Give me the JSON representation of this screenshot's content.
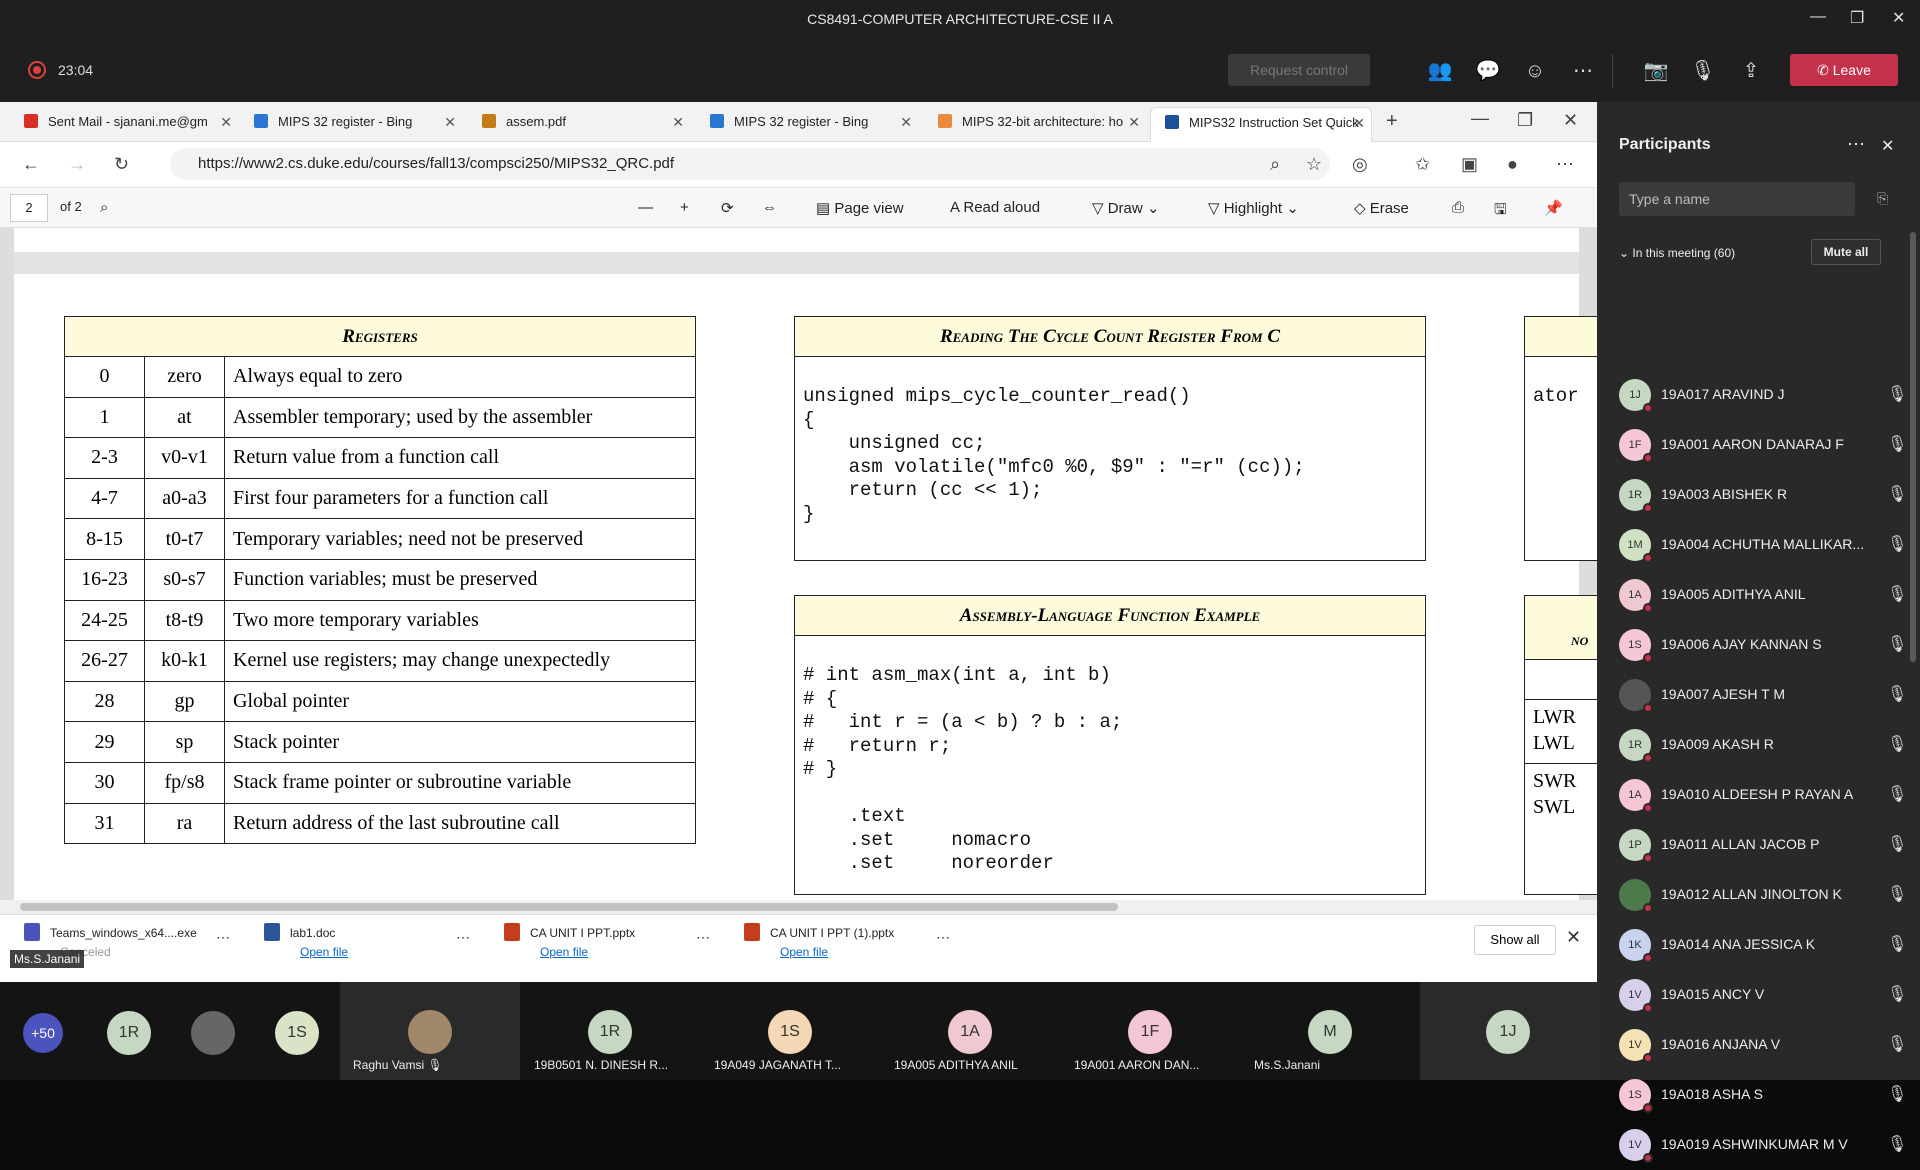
{
  "window": {
    "title": "CS8491-COMPUTER ARCHITECTURE-CSE II A"
  },
  "meeting": {
    "timer": "23:04",
    "request_control": "Request control",
    "leave": "Leave"
  },
  "browser": {
    "tabs": [
      {
        "label": "Sent Mail - sjanani.me@gm",
        "icon": "gmail-icon",
        "color": "#d93025"
      },
      {
        "label": "MIPS 32 register - Bing",
        "icon": "bing-icon",
        "color": "#2a76d2"
      },
      {
        "label": "assem.pdf",
        "icon": "pdf-icon",
        "color": "#c47b16"
      },
      {
        "label": "MIPS 32 register - Bing",
        "icon": "bing-icon",
        "color": "#2a76d2"
      },
      {
        "label": "MIPS 32-bit architecture: ho",
        "icon": "web-icon",
        "color": "#e98a3c"
      },
      {
        "label": "MIPS32 Instruction Set Quick",
        "icon": "pdf-icon",
        "color": "#1e4f9a"
      }
    ],
    "url": "https://www2.cs.duke.edu/courses/fall13/compsci250/MIPS32_QRC.pdf"
  },
  "pdf": {
    "page": "2",
    "of": "of 2",
    "tools": {
      "page_view": "Page view",
      "read_aloud": "Read aloud",
      "draw": "Draw",
      "highlight": "Highlight",
      "erase": "Erase"
    },
    "registers": {
      "heading": "Registers",
      "rows": [
        [
          "0",
          "zero",
          "Always equal to zero"
        ],
        [
          "1",
          "at",
          "Assembler temporary; used by the assembler"
        ],
        [
          "2-3",
          "v0-v1",
          "Return value from a function call"
        ],
        [
          "4-7",
          "a0-a3",
          "First four parameters for a function call"
        ],
        [
          "8-15",
          "t0-t7",
          "Temporary variables; need not be preserved"
        ],
        [
          "16-23",
          "s0-s7",
          "Function variables; must be preserved"
        ],
        [
          "24-25",
          "t8-t9",
          "Two more temporary variables"
        ],
        [
          "26-27",
          "k0-k1",
          "Kernel use registers; may change unexpectedly"
        ],
        [
          "28",
          "gp",
          "Global pointer"
        ],
        [
          "29",
          "sp",
          "Stack pointer"
        ],
        [
          "30",
          "fp/s8",
          "Stack frame pointer or subroutine variable"
        ],
        [
          "31",
          "ra",
          "Return address of the last subroutine call"
        ]
      ]
    },
    "cycle": {
      "heading": "Reading The Cycle Count Register From C",
      "code": "unsigned mips_cycle_counter_read()\n{\n    unsigned cc;\n    asm volatile(\"mfc0 %0, $9\" : \"=r\" (cc));\n    return (cc << 1);\n}"
    },
    "asm": {
      "heading": "Assembly-Language Function Example",
      "code": "# int asm_max(int a, int b)\n# {\n#   int r = (a < b) ? b : a;\n#   return r;\n# }\n\n    .text\n    .set     nomacro\n    .set     noreorder"
    },
    "right_cut": {
      "text1": "ator",
      "heading2": "NO",
      "c1": "LWR",
      "c2": "LWL",
      "c3": "SWR",
      "c4": "SWL"
    }
  },
  "downloads": {
    "items": [
      {
        "name": "Teams_windows_x64....exe",
        "sub": "Canceled",
        "color": "#4b53bc"
      },
      {
        "name": "lab1.doc",
        "sub": "Open file",
        "color": "#2b579a"
      },
      {
        "name": "CA UNIT I PPT.pptx",
        "sub": "Open file",
        "color": "#c43e1c"
      },
      {
        "name": "CA UNIT I PPT (1).pptx",
        "sub": "Open file",
        "color": "#c43e1c"
      }
    ],
    "show_all": "Show all",
    "presenter": "Ms.S.Janani"
  },
  "gallery": {
    "overflow": "+50",
    "avatars": [
      {
        "initials": "1R",
        "color": "#c7d8c2"
      },
      {
        "initials": "",
        "color": "#666"
      },
      {
        "initials": "1S",
        "color": "#d9e3c5"
      }
    ],
    "tiles": [
      {
        "initials": "",
        "name": "Raghu Vamsi",
        "color": "#a08868"
      },
      {
        "initials": "1R",
        "name": "19B0501 N. DINESH R...",
        "color": "#c7d8c2"
      },
      {
        "initials": "1S",
        "name": "19A049 JAGANATH T...",
        "color": "#f4d7b5"
      },
      {
        "initials": "1A",
        "name": "19A005 ADITHYA ANIL",
        "color": "#f0c8d0"
      },
      {
        "initials": "1F",
        "name": "19A001 AARON DAN...",
        "color": "#f5c6d4"
      },
      {
        "initials": "M",
        "name": "Ms.S.Janani",
        "color": "#c7d8c2"
      },
      {
        "initials": "1J",
        "name": "",
        "color": "#c7d8c2"
      }
    ]
  },
  "participants": {
    "title": "Participants",
    "search_placeholder": "Type a name",
    "in_meeting": "In this meeting (60)",
    "mute_all": "Mute all",
    "list": [
      {
        "initials": "1J",
        "name": "19A017 ARAVIND J",
        "color": "#c7d8c2"
      },
      {
        "initials": "1F",
        "name": "19A001 AARON DANARAJ F",
        "color": "#f5c6d4"
      },
      {
        "initials": "1R",
        "name": "19A003 ABISHEK R",
        "color": "#c7d8c2"
      },
      {
        "initials": "1M",
        "name": "19A004 ACHUTHA MALLIKAR...",
        "color": "#cfe0c3"
      },
      {
        "initials": "1A",
        "name": "19A005 ADITHYA ANIL",
        "color": "#f0c8d0"
      },
      {
        "initials": "1S",
        "name": "19A006 AJAY KANNAN S",
        "color": "#f5c6d4"
      },
      {
        "initials": "",
        "name": "19A007 AJESH T M",
        "color": "#555"
      },
      {
        "initials": "1R",
        "name": "19A009 AKASH R",
        "color": "#c7d8c2"
      },
      {
        "initials": "1A",
        "name": "19A010 ALDEESH P RAYAN A",
        "color": "#f5c6d4"
      },
      {
        "initials": "1P",
        "name": "19A011 ALLAN JACOB P",
        "color": "#c7d8c2"
      },
      {
        "initials": "",
        "name": "19A012 ALLAN JINOLTON K",
        "color": "#4d7a4a"
      },
      {
        "initials": "1K",
        "name": "19A014 ANA JESSICA K",
        "color": "#c9d3ef"
      },
      {
        "initials": "1V",
        "name": "19A015 ANCY V",
        "color": "#d8d0ea"
      },
      {
        "initials": "1V",
        "name": "19A016 ANJANA V",
        "color": "#f4e2b5"
      },
      {
        "initials": "1S",
        "name": "19A018 ASHA S",
        "color": "#f5c6d4"
      },
      {
        "initials": "1V",
        "name": "19A019 ASHWINKUMAR M V",
        "color": "#d8d0ea"
      }
    ]
  }
}
